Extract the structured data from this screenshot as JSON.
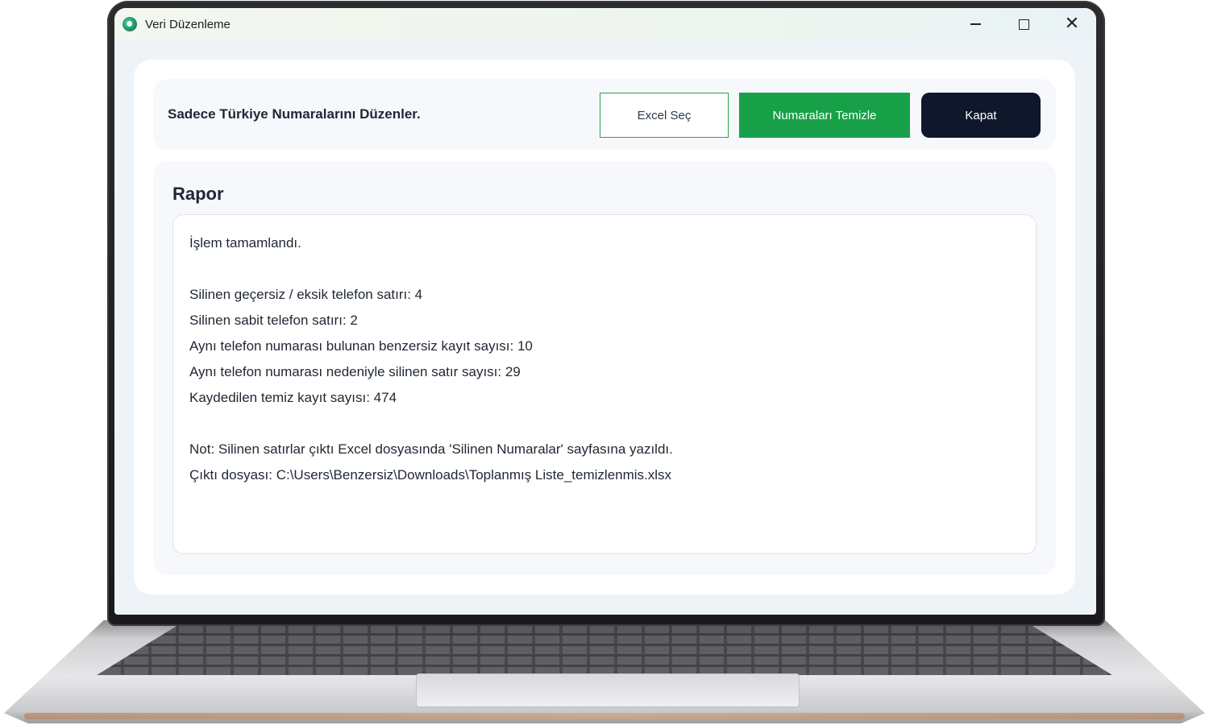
{
  "window": {
    "title": "Veri Düzenleme",
    "controls": [
      "minimize",
      "maximize",
      "close"
    ]
  },
  "header": {
    "subtitle": "Sadece Türkiye Numaralarını Düzenler.",
    "buttons": {
      "excel_select": "Excel Seç",
      "clean_numbers": "Numaraları Temizle",
      "close": "Kapat"
    }
  },
  "report": {
    "title": "Rapor",
    "lines": [
      "İşlem tamamlandı.",
      "",
      "Silinen geçersiz / eksik telefon satırı: 4",
      "Silinen sabit telefon satırı: 2",
      "Aynı telefon numarası bulunan benzersiz kayıt sayısı: 10",
      "Aynı telefon numarası nedeniyle silinen satır sayısı: 29",
      "Kaydedilen temiz kayıt sayısı: 474",
      "",
      "Not: Silinen satırlar çıktı Excel dosyasında 'Silinen Numaralar' sayfasına yazıldı.",
      "Çıktı dosyası: C:\\Users\\Benzersiz\\Downloads\\Toplanmış Liste_temizlenmis.xlsx"
    ]
  },
  "colors": {
    "primary_green": "#18a048",
    "dark_button": "#0f172a",
    "panel_bg": "#f6f8fb"
  }
}
